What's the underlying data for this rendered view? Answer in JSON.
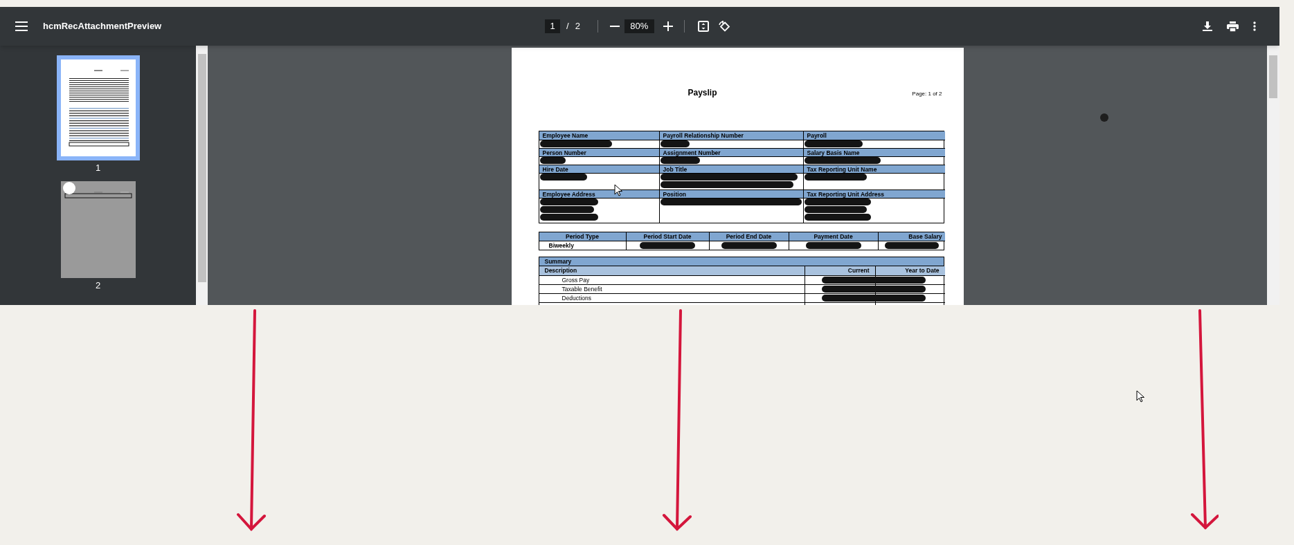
{
  "toolbar": {
    "title": "hcmRecAttachmentPreview",
    "page_current": "1",
    "page_separator": "/",
    "page_total": "2",
    "zoom": "80%"
  },
  "thumbnails": [
    {
      "label": "1",
      "selected": true
    },
    {
      "label": "2",
      "selected": false
    }
  ],
  "document": {
    "title": "Payslip",
    "page_label": "Page: 1 of 2",
    "employee_table": [
      {
        "cells": [
          {
            "label": "Employee Name",
            "redacted": true,
            "kind": "line"
          },
          {
            "label": "Payroll Relationship Number",
            "redacted": true,
            "kind": "line"
          },
          {
            "label": "Payroll",
            "redacted": true,
            "kind": "line"
          }
        ]
      },
      {
        "cells": [
          {
            "label": "Person Number",
            "redacted": true,
            "kind": "line"
          },
          {
            "label": "Assignment Number",
            "redacted": true,
            "kind": "line"
          },
          {
            "label": "Salary Basis Name",
            "redacted": true,
            "kind": "line"
          }
        ]
      },
      {
        "cells": [
          {
            "label": "Hire Date",
            "redacted": true,
            "kind": "line"
          },
          {
            "label": "Job Title",
            "redacted": true,
            "kind": "double"
          },
          {
            "label": "Tax Reporting Unit Name",
            "redacted": true,
            "kind": "line"
          }
        ]
      },
      {
        "cells": [
          {
            "label": "Employee Address",
            "redacted": true,
            "kind": "triple"
          },
          {
            "label": "Position",
            "redacted": true,
            "kind": "line"
          },
          {
            "label": "Tax Reporting Unit Address",
            "redacted": true,
            "kind": "triple"
          }
        ]
      }
    ],
    "period_table": {
      "columns": [
        "Period Type",
        "Period Start Date",
        "Period End Date",
        "Payment Date",
        "Base Salary"
      ],
      "values": [
        {
          "text": "Biweekly"
        },
        {
          "redacted": true
        },
        {
          "redacted": true
        },
        {
          "redacted": true
        },
        {
          "redacted": true
        }
      ]
    },
    "summary_table": {
      "title": "Summary",
      "columns": [
        "Description",
        "Current",
        "Year to Date"
      ],
      "rows": [
        {
          "description": "Gross Pay",
          "redacted": true
        },
        {
          "description": "Taxable Benefit",
          "redacted": true
        },
        {
          "description": "Deductions",
          "redacted": true
        }
      ]
    }
  }
}
